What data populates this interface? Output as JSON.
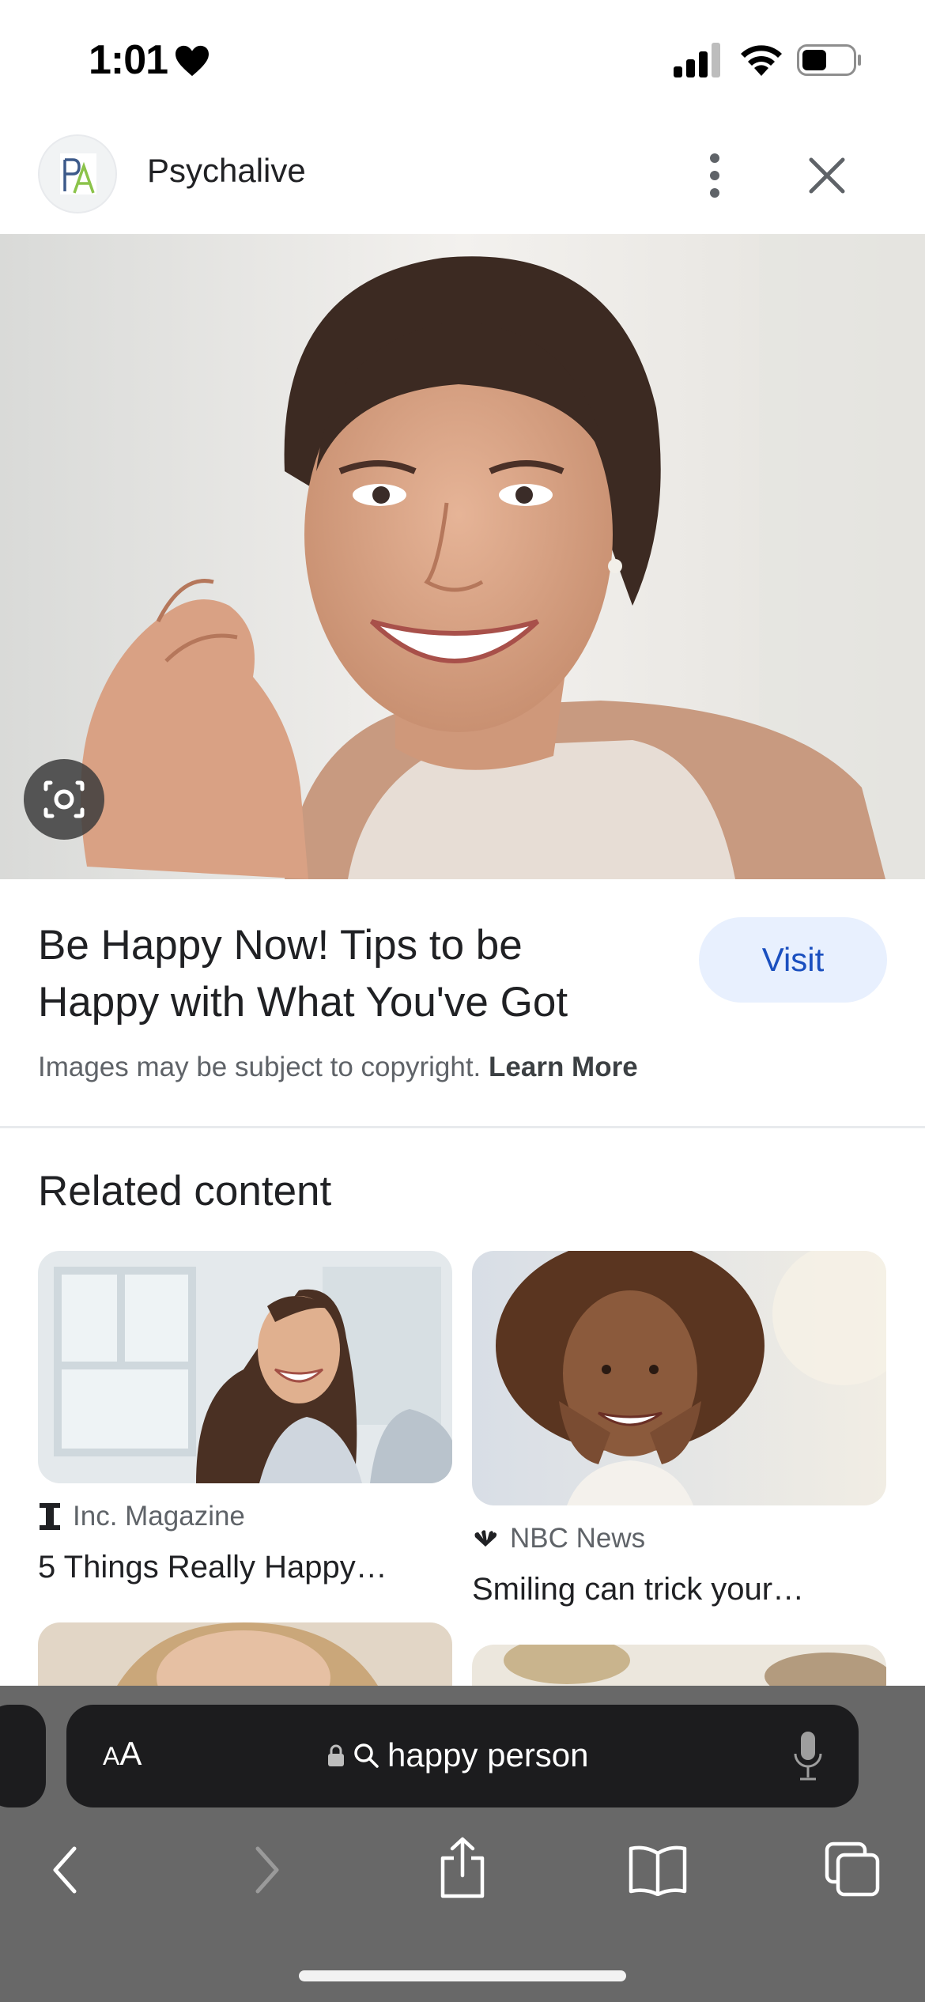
{
  "status_bar": {
    "time": "1:01"
  },
  "header": {
    "logo_text": "PA",
    "site_name": "Psychalive"
  },
  "result": {
    "title": "Be Happy Now! Tips to be Happy with What You've Got",
    "visit_label": "Visit",
    "copyright_text": "Images may be subject to copyright.",
    "learn_more_label": "Learn More"
  },
  "related": {
    "heading": "Related content",
    "cards": [
      {
        "source": "Inc. Magazine",
        "title": "5 Things Really Happy…"
      },
      {
        "source": "NBC News",
        "title": "Smiling can trick your…"
      }
    ]
  },
  "browser": {
    "text_size_label": "AA",
    "address_text": "happy person"
  },
  "colors": {
    "visit_bg": "#e8f0fe",
    "visit_text": "#1a4fbf",
    "toolbar_bg": "#686868"
  }
}
